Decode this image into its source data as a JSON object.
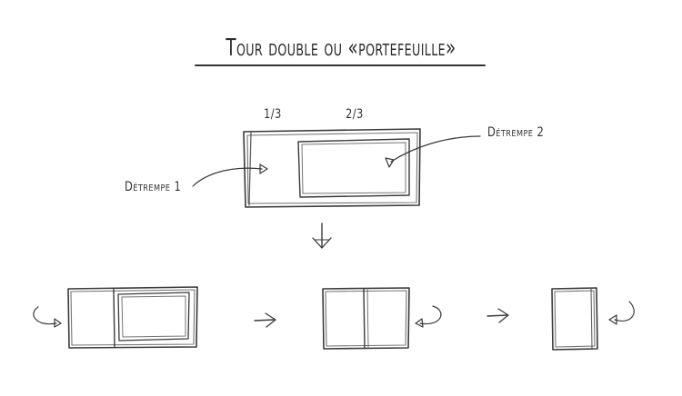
{
  "title": "Tour double ou «portefeuille»",
  "labels": {
    "fraction_left": "1/3",
    "fraction_right": "2/3",
    "detrempe_1": "Détrempe 1",
    "detrempe_2": "Détrempe 2"
  },
  "icons": [
    "down-arrow-icon",
    "right-arrow-icon",
    "fold-arrow-icon"
  ]
}
